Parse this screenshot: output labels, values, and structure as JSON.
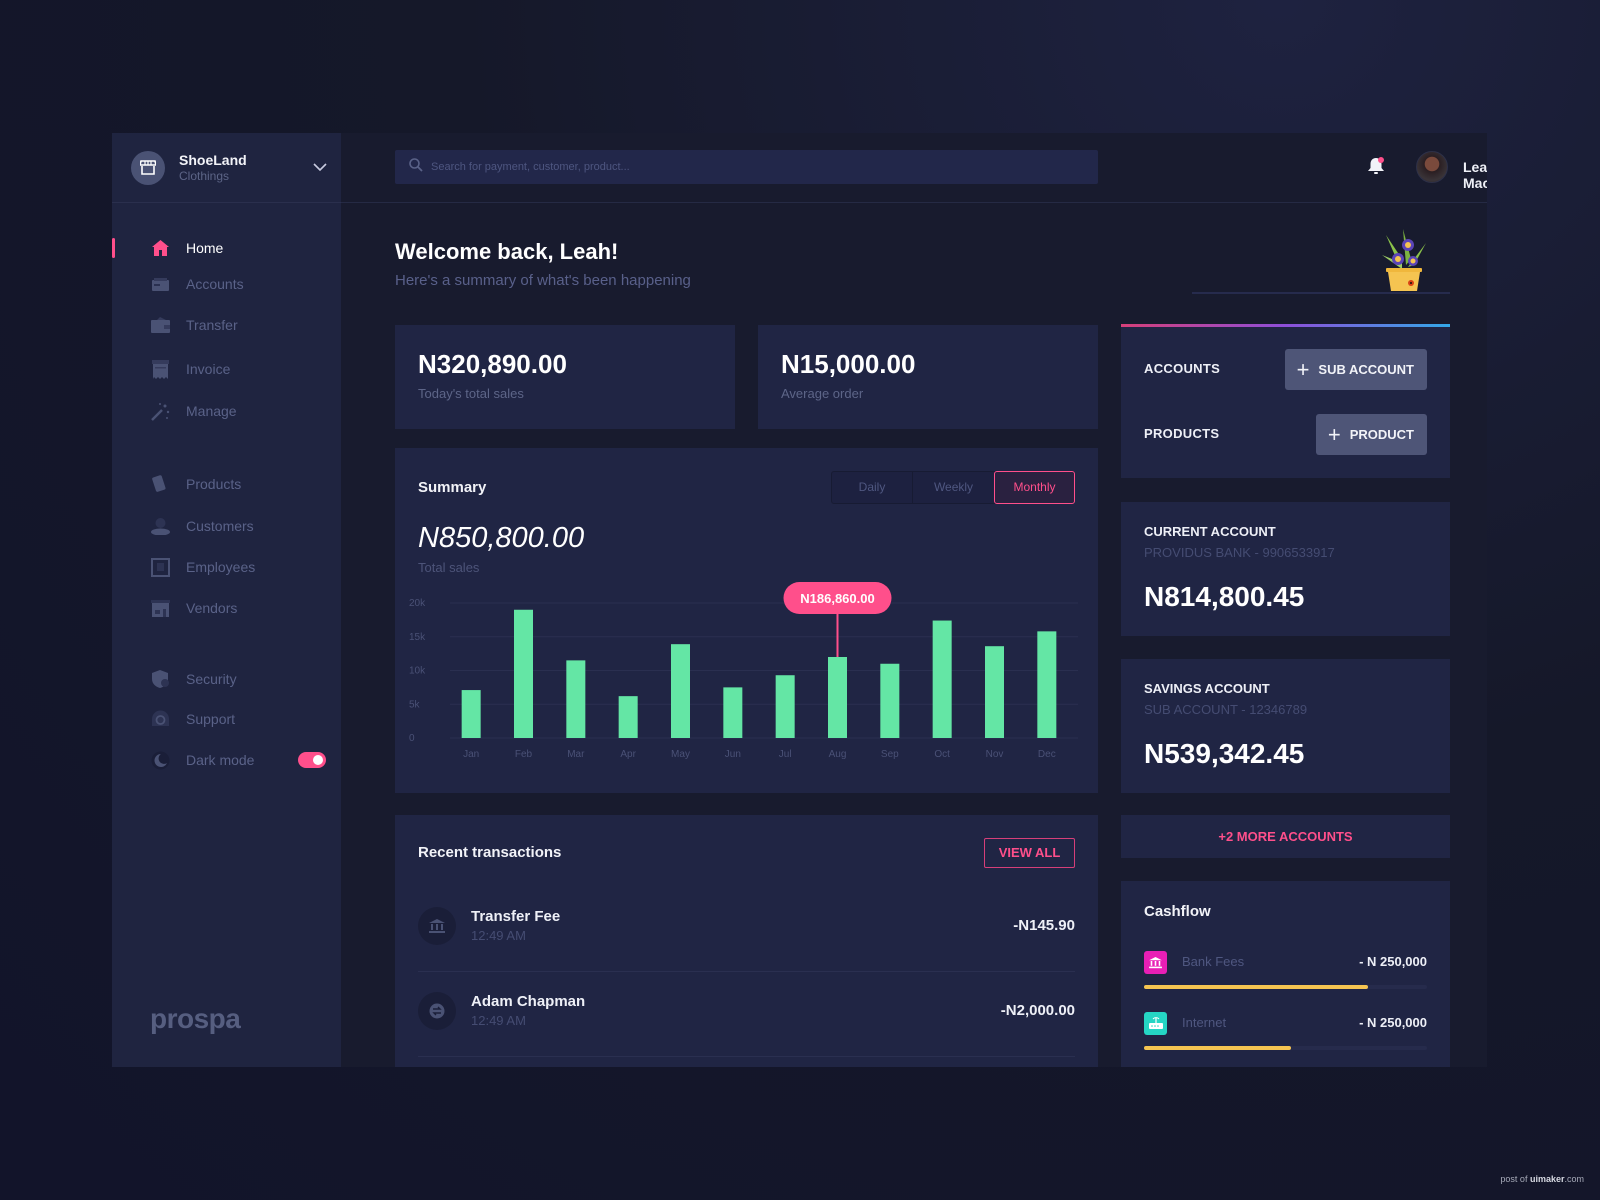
{
  "brand": {
    "name": "ShoeLand",
    "subtitle": "Clothings",
    "logo_text": "prospa"
  },
  "nav": {
    "items": [
      {
        "label": "Home",
        "icon": "home-icon",
        "active": true
      },
      {
        "label": "Accounts",
        "icon": "card-icon",
        "active": false
      },
      {
        "label": "Transfer",
        "icon": "wallet-icon",
        "active": false
      },
      {
        "label": "Invoice",
        "icon": "receipt-icon",
        "active": false
      },
      {
        "label": "Manage",
        "icon": "magic-wand-icon",
        "active": false
      },
      {
        "label": "Products",
        "icon": "tag-icon",
        "active": false
      },
      {
        "label": "Customers",
        "icon": "user-icon",
        "active": false
      },
      {
        "label": "Employees",
        "icon": "id-badge-icon",
        "active": false
      },
      {
        "label": "Vendors",
        "icon": "store-icon",
        "active": false
      },
      {
        "label": "Security",
        "icon": "shield-icon",
        "active": false
      },
      {
        "label": "Support",
        "icon": "headset-icon",
        "active": false
      },
      {
        "label": "Dark mode",
        "icon": "moon-icon",
        "active": false
      }
    ],
    "dark_mode_on": true
  },
  "topbar": {
    "search_placeholder": "Search for payment, customer, product...",
    "user_name": "Leah Macharia",
    "has_notification": true
  },
  "welcome": {
    "title": "Welcome back, Leah!",
    "subtitle": "Here's a summary of what's been happening"
  },
  "stats": [
    {
      "value": "N320,890.00",
      "label": "Today's total sales"
    },
    {
      "value": "N15,000.00",
      "label": "Average order"
    }
  ],
  "summary": {
    "title": "Summary",
    "periods": [
      "Daily",
      "Weekly",
      "Monthly"
    ],
    "selected_period": "Monthly",
    "total": "N850,800.00",
    "total_label": "Total sales",
    "tooltip": "N186,860.00"
  },
  "chart_data": {
    "type": "bar",
    "title": "Summary",
    "categories": [
      "Jan",
      "Feb",
      "Mar",
      "Apr",
      "May",
      "Jun",
      "Jul",
      "Aug",
      "Sep",
      "Oct",
      "Nov",
      "Dec"
    ],
    "values": [
      7100,
      19000,
      11500,
      6200,
      13900,
      7500,
      9300,
      12000,
      11000,
      17400,
      13600,
      15800
    ],
    "yticks": [
      "0",
      "5k",
      "10k",
      "15k",
      "20k"
    ],
    "ylim": [
      0,
      20000
    ],
    "xlabel": "",
    "ylabel": "",
    "grid": true,
    "highlight_index": 7,
    "highlight_label": "N186,860.00",
    "bar_color": "#64e6a5",
    "highlight_color": "#ff4f8b"
  },
  "transactions": {
    "title": "Recent transactions",
    "view_all_label": "VIEW ALL",
    "items": [
      {
        "name": "Transfer Fee",
        "time": "12:49 AM",
        "amount": "-N145.90",
        "icon": "bank-icon"
      },
      {
        "name": "Adam Chapman",
        "time": "12:49 AM",
        "amount": "-N2,000.00",
        "icon": "transfer-icon"
      }
    ]
  },
  "quick_actions": {
    "accounts_label": "ACCOUNTS",
    "sub_account_button": "SUB ACCOUNT",
    "products_label": "PRODUCTS",
    "product_button": "PRODUCT"
  },
  "accounts": [
    {
      "title": "CURRENT ACCOUNT",
      "subtitle": "PROVIDUS BANK - 9906533917",
      "balance": "N814,800.45"
    },
    {
      "title": "SAVINGS ACCOUNT",
      "subtitle": "SUB ACCOUNT - 12346789",
      "balance": "N539,342.45"
    }
  ],
  "more_accounts_label": "+2 MORE ACCOUNTS",
  "cashflow": {
    "title": "Cashflow",
    "items": [
      {
        "label": "Bank Fees",
        "amount": "- N 250,000",
        "progress": 0.79,
        "icon": "bank-icon",
        "icon_color": "#e81fb5"
      },
      {
        "label": "Internet",
        "amount": "- N 250,000",
        "progress": 0.52,
        "icon": "router-icon",
        "icon_color": "#25d6c4"
      }
    ]
  },
  "credit": {
    "prefix": "post of ",
    "brand": "uimaker",
    "suffix": ".com"
  }
}
